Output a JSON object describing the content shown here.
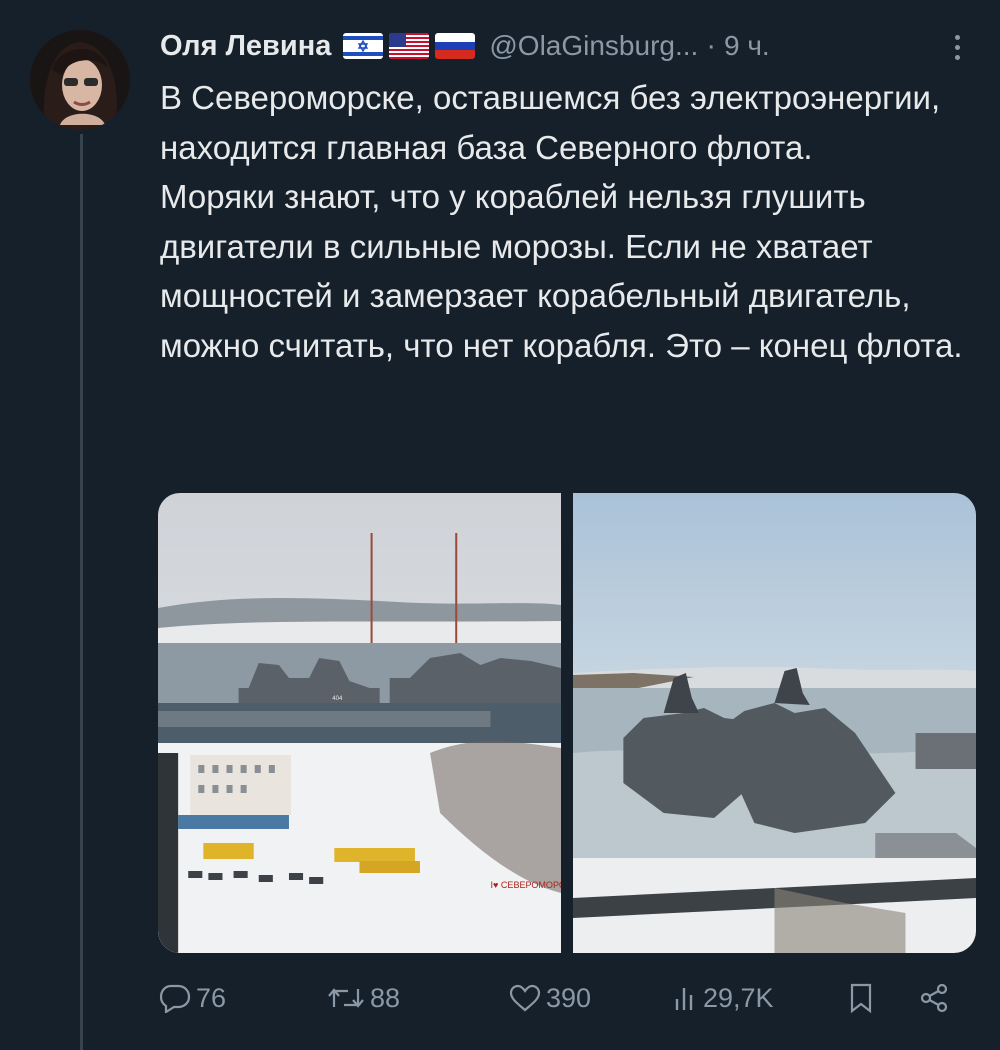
{
  "author": {
    "display_name": "Оля Левина",
    "handle": "@OlaGinsburg...",
    "separator": "·",
    "time": "9 ч.",
    "flags": [
      "israel-flag",
      "usa-flag",
      "russia-flag"
    ]
  },
  "tweet": {
    "paragraph_1": "В Североморске, оставшемся без электроэнергии, находится главная база Северного флота.",
    "paragraph_2": "Моряки знают, что у кораблей нельзя глушить двигатели в сильные морозы. Если не хватает мощностей и замерзает корабельный двигатель, можно считать, что нет корабля. Это – конец флота."
  },
  "media": {
    "photo_left_sign": "I♥ СЕВЕРОМОРСК",
    "photo_left_hull": "404"
  },
  "actions": {
    "replies": "76",
    "reposts": "88",
    "likes": "390",
    "views": "29,7K"
  },
  "colors": {
    "background": "#15202b",
    "text": "#e7e9ea",
    "muted": "#8b98a5"
  }
}
